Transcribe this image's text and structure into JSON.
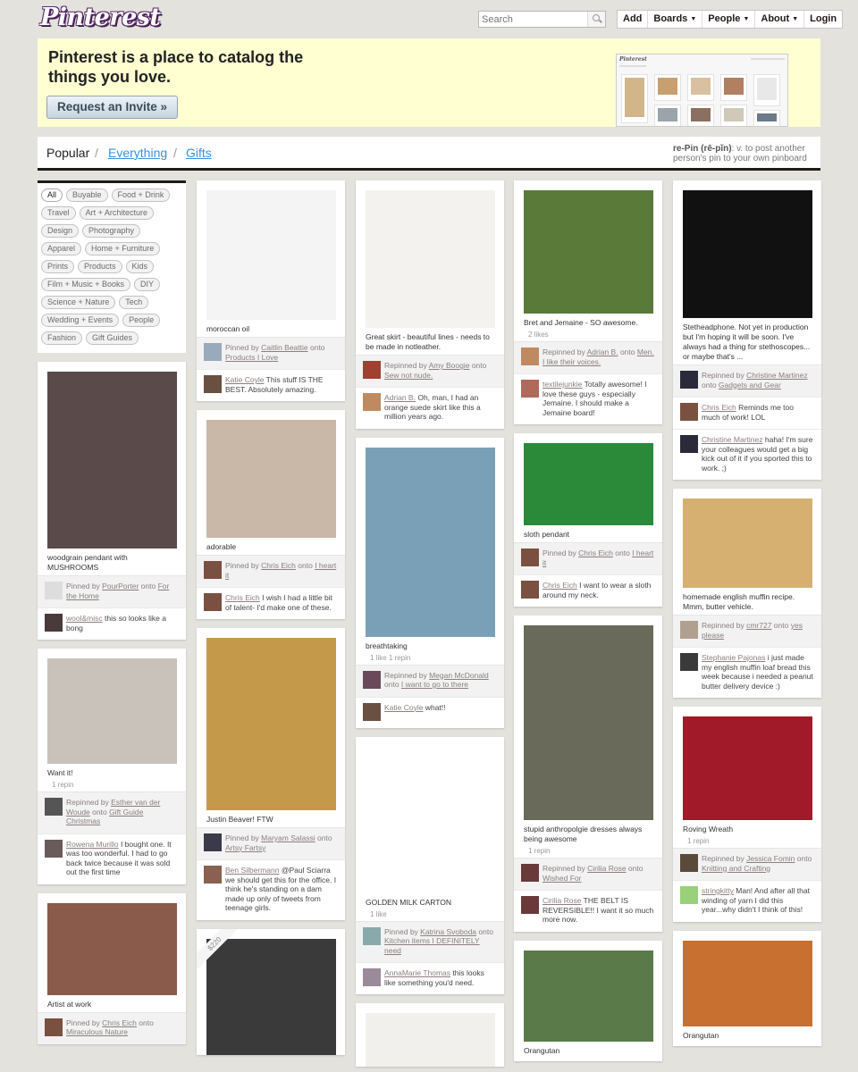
{
  "logo": "Pinterest",
  "search": {
    "placeholder": "Search"
  },
  "nav": {
    "add": "Add",
    "boards": "Boards",
    "people": "People",
    "about": "About",
    "login": "Login"
  },
  "banner": {
    "headline": "Pinterest is a place to catalog the things you love.",
    "invite_button": "Request an Invite »",
    "screenshot_logo": "Pinterest"
  },
  "filters": {
    "popular": "Popular",
    "sep": "/",
    "everything": "Everything",
    "gifts": "Gifts"
  },
  "repin_definition": {
    "term": "re-Pin (rē-pĭn)",
    "text": ": v. to post another person's pin to your own pinboard"
  },
  "categories": [
    "All",
    "Buyable",
    "Food + Drink",
    "Travel",
    "Art + Architecture",
    "Design",
    "Photography",
    "Apparel",
    "Home + Furniture",
    "Prints",
    "Products",
    "Kids",
    "Film + Music + Books",
    "DIY",
    "Science + Nature",
    "Tech",
    "Wedding + Events",
    "People",
    "Fashion",
    "Gift Guides"
  ],
  "columns": [
    {
      "pins": [
        {
          "desc": "woodgrain pendant with MUSHROOMS",
          "stats": "",
          "img_h": 198,
          "bg": "#5a4a4a",
          "comments": [
            {
              "lead": "Pinned by ",
              "user": "PourPorter",
              "mid": " onto ",
              "board": "For the Home",
              "text": "",
              "av": "#ddd"
            },
            {
              "lead": "",
              "user": "wool&misc",
              "mid": "",
              "board": "",
              "text": " this so looks like a bong",
              "av": "#4a3a3a"
            }
          ]
        },
        {
          "desc": "Want it!",
          "stats": "1 repin",
          "img_h": 118,
          "bg": "#c9c2bb",
          "comments": [
            {
              "lead": "Repinned by ",
              "user": "Esther van der Woude",
              "mid": " onto ",
              "board": "Gift Guide Christmas",
              "text": "",
              "av": "#555"
            },
            {
              "lead": "",
              "user": "Rowena Murillo",
              "mid": "",
              "board": "",
              "text": " I bought one. It was too wonderful. I had to go back twice because it was sold out the first time",
              "av": "#6a5a5a"
            }
          ]
        },
        {
          "desc": "Artist at work",
          "stats": "",
          "img_h": 103,
          "bg": "#8a5a4a",
          "comments": [
            {
              "lead": "Pinned by ",
              "user": "Chris Eich",
              "mid": " onto ",
              "board": "Miraculous Nature",
              "text": "",
              "av": "#7a5040"
            }
          ]
        }
      ]
    },
    {
      "pins": [
        {
          "desc": "moroccan oil",
          "stats": "",
          "img_h": 145,
          "bg": "#f4f4f4",
          "comments": [
            {
              "lead": "Pinned by ",
              "user": "Caitlin Beattie",
              "mid": " onto ",
              "board": "Products I Love",
              "text": "",
              "av": "#9ab"
            },
            {
              "lead": "",
              "user": "Katie Coyle",
              "mid": "",
              "board": "",
              "text": " This stuff IS THE BEST. Absolutely amazing.",
              "av": "#6a5040"
            }
          ]
        },
        {
          "desc": "adorable",
          "stats": "",
          "img_h": 132,
          "bg": "#c9b8a8",
          "comments": [
            {
              "lead": "Pinned by ",
              "user": "Chris Eich",
              "mid": " onto ",
              "board": "I heart it",
              "text": "",
              "av": "#7a5040"
            },
            {
              "lead": "",
              "user": "Chris Eich",
              "mid": "",
              "board": "",
              "text": " I wish I had a little bit of talent- I'd make one of these.",
              "av": "#7a5040"
            }
          ]
        },
        {
          "desc": "Justin Beaver! FTW",
          "stats": "",
          "img_h": 193,
          "bg": "#c49a4a",
          "comments": [
            {
              "lead": "Pinned by ",
              "user": "Maryam Salassi",
              "mid": " onto ",
              "board": "Artsy Fartsy",
              "text": "",
              "av": "#3a3a4a"
            },
            {
              "lead": "",
              "user": "Ben Silbermann",
              "mid": "",
              "board": "",
              "text": " @Paul Sciarra we should get this for the office. I think he's standing on a dam made up only of tweets from teenage girls.",
              "av": "#8a6050"
            }
          ]
        },
        {
          "desc": "",
          "stats": "",
          "img_h": 130,
          "bg": "#3a3a3a",
          "price": "$220",
          "comments": []
        }
      ]
    },
    {
      "pins": [
        {
          "desc": "Great skirt - beautiful lines - needs to be made in notleather.",
          "stats": "",
          "img_h": 154,
          "bg": "#f4f2ee",
          "comments": [
            {
              "lead": "Repinned by ",
              "user": "Amy Boogie",
              "mid": " onto ",
              "board": "Sew not nude.",
              "text": "",
              "av": "#a04030"
            },
            {
              "lead": "",
              "user": "Adrian B.",
              "mid": "",
              "board": "",
              "text": " Oh, man, I had an orange suede skirt like this a million years ago.",
              "av": "#c08a60"
            }
          ]
        },
        {
          "desc": "breathtaking",
          "stats": "1 like    1 repin",
          "img_h": 212,
          "bg": "#7aa0b8",
          "comments": [
            {
              "lead": "Repinned by ",
              "user": "Megan McDonald",
              "mid": " onto ",
              "board": "I want to go to there",
              "text": "",
              "av": "#6a4a5a"
            },
            {
              "lead": "",
              "user": "Katie Coyle",
              "mid": "",
              "board": "",
              "text": " what!!",
              "av": "#6a5040"
            }
          ]
        },
        {
          "desc": "GOLDEN MILK CARTON",
          "stats": "1 like",
          "img_h": 164,
          "bg": "#ffffff",
          "comments": [
            {
              "lead": "Pinned by ",
              "user": "Katrina Svoboda",
              "mid": " onto ",
              "board": "Kitchen items I DEFINITELY need",
              "text": "",
              "av": "#8aa"
            },
            {
              "lead": "",
              "user": "AnnaMarie Thomas",
              "mid": "",
              "board": "",
              "text": " this looks like something you'd need.",
              "av": "#9a8a9a"
            }
          ]
        },
        {
          "desc": "",
          "stats": "",
          "img_h": 60,
          "bg": "#f2f0ec",
          "comments": []
        }
      ]
    },
    {
      "pins": [
        {
          "desc": "Bret and Jemaine - SO awesome.",
          "stats": "2 likes",
          "img_h": 138,
          "bg": "#5a7a3a",
          "comments": [
            {
              "lead": "Repinned by ",
              "user": "Adrian B.",
              "mid": " onto ",
              "board": "Men. I like their voices.",
              "text": "",
              "av": "#c08a60"
            },
            {
              "lead": "",
              "user": "textilejunkie",
              "mid": "",
              "board": "",
              "text": " Totally awesome! I love these guys - especially Jemaine. I should make a Jemaine board!",
              "av": "#b06a5a"
            }
          ]
        },
        {
          "desc": "sloth pendant",
          "stats": "",
          "img_h": 92,
          "bg": "#2a8a3a",
          "comments": [
            {
              "lead": "Pinned by ",
              "user": "Chris Eich",
              "mid": " onto ",
              "board": "I heart it",
              "text": "",
              "av": "#7a5040"
            },
            {
              "lead": "",
              "user": "Chris Eich",
              "mid": "",
              "board": "",
              "text": " I want to wear a sloth around my neck.",
              "av": "#7a5040"
            }
          ]
        },
        {
          "desc": "stupid anthropolgie dresses always being awesome",
          "stats": "1 repin",
          "img_h": 218,
          "bg": "#6a6a5a",
          "comments": [
            {
              "lead": "Repinned by ",
              "user": "Cirilia Rose",
              "mid": " onto ",
              "board": "Wished For",
              "text": "",
              "av": "#6a3a3a"
            },
            {
              "lead": "",
              "user": "Cirilia Rose",
              "mid": "",
              "board": "",
              "text": " THE BELT IS REVERSIBLE!! I want it so much more now.",
              "av": "#6a3a3a"
            }
          ]
        },
        {
          "desc": "Orangutan",
          "stats": "",
          "img_h": 102,
          "bg": "#5a7a4a",
          "comments": []
        }
      ]
    },
    {
      "pins": [
        {
          "desc": "Stetheadphone. Not yet in production but I'm hoping it will be soon. I've always had a thing for stethoscopes... or maybe that's ...",
          "stats": "",
          "img_h": 143,
          "bg": "#111111",
          "comments": [
            {
              "lead": "Repinned by ",
              "user": "Christine Martinez",
              "mid": " onto ",
              "board": "Gadgets and Gear",
              "text": "",
              "av": "#2a2a3a"
            },
            {
              "lead": "",
              "user": "Chris Eich",
              "mid": "",
              "board": "",
              "text": " Reminds me too much of work! LOL",
              "av": "#7a5040"
            },
            {
              "lead": "",
              "user": "Christine Martinez",
              "mid": "",
              "board": "",
              "text": " haha! I'm sure your colleagues would get a big kick out of it if you sported this to work. ;)",
              "av": "#2a2a3a"
            }
          ]
        },
        {
          "desc": "homemade english muffin recipe. Mmm, butter vehicle.",
          "stats": "",
          "img_h": 100,
          "bg": "#d6b070",
          "comments": [
            {
              "lead": "Repinned by ",
              "user": "cmr727",
              "mid": " onto ",
              "board": "yes please",
              "text": "",
              "av": "#b0a090"
            },
            {
              "lead": "",
              "user": "Stephanie Pajonas",
              "mid": "",
              "board": "",
              "text": " i just made my english muffin loaf bread this week because i needed a peanut butter delivery device :)",
              "av": "#3a3a3a"
            }
          ]
        },
        {
          "desc": "Roving Wreath",
          "stats": "1 repin",
          "img_h": 116,
          "bg": "#a01a2a",
          "comments": [
            {
              "lead": "Repinned by ",
              "user": "Jessica Fomin",
              "mid": " onto ",
              "board": "Knitting and Crafting",
              "text": "",
              "av": "#5a4a3a"
            },
            {
              "lead": "",
              "user": "stringkitty",
              "mid": "",
              "board": "",
              "text": " Man! And after all that winding of yarn I did this year...why didn't I think of this!",
              "av": "#9ad07a"
            }
          ]
        },
        {
          "desc": "Orangutan",
          "stats": "",
          "img_h": 96,
          "bg": "#c87030",
          "comments": []
        }
      ]
    }
  ]
}
